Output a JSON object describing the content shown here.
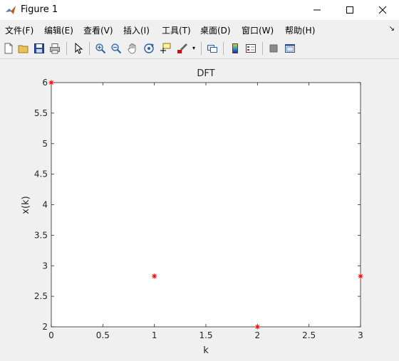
{
  "window": {
    "title": "Figure 1"
  },
  "menu": {
    "items": [
      {
        "label": "文件(F)"
      },
      {
        "label": "编辑(E)"
      },
      {
        "label": "查看(V)"
      },
      {
        "label": "插入(I)"
      },
      {
        "label": "工具(T)"
      },
      {
        "label": "桌面(D)"
      },
      {
        "label": "窗口(W)"
      },
      {
        "label": "帮助(H)"
      }
    ]
  },
  "toolbar": {
    "icons": [
      "new-figure-icon",
      "open-file-icon",
      "save-icon",
      "print-icon",
      "edit-plot-icon",
      "zoom-in-icon",
      "zoom-out-icon",
      "pan-icon",
      "rotate-3d-icon",
      "data-cursor-icon",
      "brush-icon",
      "link-plot-icon",
      "colorbar-icon",
      "legend-icon",
      "hide-plot-tools-icon",
      "show-plot-tools-icon"
    ]
  },
  "chart_data": {
    "type": "scatter",
    "title": "DFT",
    "xlabel": "k",
    "ylabel": "x(k)",
    "xlim": [
      0,
      3
    ],
    "ylim": [
      2,
      6
    ],
    "xticks": [
      "0",
      "0.5",
      "1",
      "1.5",
      "2",
      "2.5",
      "3"
    ],
    "yticks": [
      "2",
      "2.5",
      "3",
      "3.5",
      "4",
      "4.5",
      "5",
      "5.5",
      "6"
    ],
    "grid": false,
    "marker": "*",
    "marker_color": "#ff0000",
    "series": [
      {
        "x": [
          0,
          1,
          2,
          3
        ],
        "y": [
          6,
          2.83,
          2,
          2.83
        ]
      }
    ]
  }
}
